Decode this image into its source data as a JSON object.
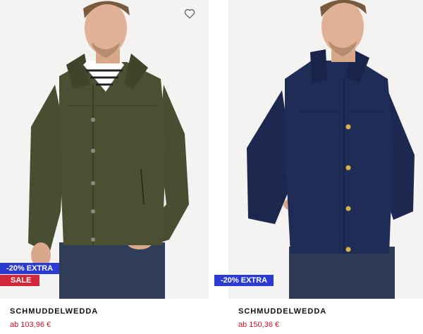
{
  "products": [
    {
      "brand": "SCHMUDDELWEDDA",
      "price": "ab 103,96 €",
      "badges": {
        "extra": "-20% EXTRA",
        "sale": "SALE"
      },
      "jacket_color": "#4b5033",
      "icons": {
        "wishlist": "heart-outline-icon"
      }
    },
    {
      "brand": "SCHMUDDELWEDDA",
      "price": "ab 150,36 €",
      "badges": {
        "extra": "-20% EXTRA"
      },
      "jacket_color": "#1f2c55"
    }
  ],
  "colors": {
    "extra_badge": "#2b3bd1",
    "sale_badge": "#d4263a",
    "price": "#c9152c"
  }
}
